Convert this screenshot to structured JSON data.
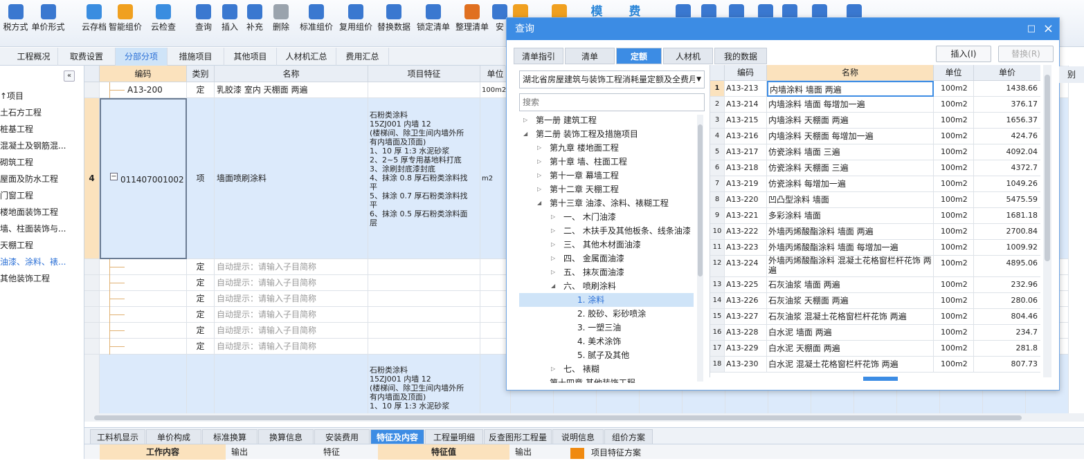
{
  "toolbar": {
    "buttons": [
      {
        "label": "税方式",
        "icon": "tax-mode-icon",
        "color": "#3a78d0"
      },
      {
        "label": "单价形式",
        "icon": "unit-price-form-icon",
        "color": "#3a78d0"
      },
      {
        "label": "云存档",
        "icon": "cloud-archive-icon",
        "color": "#3a8de0"
      },
      {
        "label": "智能组价",
        "icon": "smart-pricing-icon",
        "color": "#f0a020"
      },
      {
        "label": "云检查",
        "icon": "cloud-check-icon",
        "color": "#3a8de0"
      },
      {
        "label": "查询",
        "icon": "query-icon",
        "color": "#3a78d0"
      },
      {
        "label": "插入",
        "icon": "insert-icon",
        "color": "#3a78d0"
      },
      {
        "label": "补充",
        "icon": "supplement-icon",
        "color": "#3a78d0"
      },
      {
        "label": "删除",
        "icon": "delete-icon",
        "color": "#9aa3ad"
      },
      {
        "label": "标准组价",
        "icon": "standard-pricing-icon",
        "color": "#3a78d0"
      },
      {
        "label": "复用组价",
        "icon": "reuse-pricing-icon",
        "color": "#3a78d0"
      },
      {
        "label": "替换数据",
        "icon": "replace-data-icon",
        "color": "#3a78d0"
      },
      {
        "label": "锁定清单",
        "icon": "lock-icon",
        "color": "#3a78d0"
      },
      {
        "label": "整理清单",
        "icon": "organize-list-icon",
        "color": "#e07020"
      },
      {
        "label": "安",
        "icon": "install-icon",
        "color": "#3a78d0"
      },
      {
        "label": "",
        "icon": "coins-icon",
        "color": "#f0a020"
      },
      {
        "label": "",
        "icon": "gear-icon",
        "color": "#f0a020"
      },
      {
        "label": "",
        "icon": "template-icon",
        "color": "#2b86d8"
      },
      {
        "label": "",
        "icon": "fee-icon",
        "color": "#2b86d8"
      },
      {
        "label": "",
        "icon": "paint-icon",
        "color": "#3a78d0"
      },
      {
        "label": "",
        "icon": "structure-icon",
        "color": "#3a78d0"
      },
      {
        "label": "",
        "icon": "binoculars-icon",
        "color": "#3a78d0"
      },
      {
        "label": "",
        "icon": "filter-icon",
        "color": "#3a78d0"
      },
      {
        "label": "",
        "icon": "grid-icon",
        "color": "#3a78d0"
      },
      {
        "label": "",
        "icon": "search-doc-icon",
        "color": "#3a78d0"
      },
      {
        "label": "",
        "icon": "list-icon",
        "color": "#3a78d0"
      }
    ],
    "template_glyph": "模",
    "fee_glyph": "费"
  },
  "tabs": [
    "工程概况",
    "取费设置",
    "分部分项",
    "措施项目",
    "其他项目",
    "人材机汇总",
    "费用汇总"
  ],
  "active_tab": "分部分项",
  "left_tree": {
    "collapse_glyph": "«",
    "items": [
      "↑项目",
      "土石方工程",
      "桩基工程",
      "混凝土及钢筋混...",
      "砌筑工程",
      "屋面及防水工程",
      "门窗工程",
      "楼地面装饰工程",
      "墙、柱面装饰与...",
      "天棚工程",
      "油漆、涂料、裱...",
      "其他装饰工程"
    ],
    "active_item": "油漆、涂料、裱..."
  },
  "main_grid": {
    "headers": [
      "编码",
      "类别",
      "名称",
      "项目特征",
      "单位"
    ],
    "rows": [
      {
        "no": "",
        "code": "A13-200",
        "type": "定",
        "name": "乳胶漆 室内 天棚面 两遍",
        "feature": "",
        "unit": "100m2"
      },
      {
        "no": "4",
        "code": "011407001002",
        "type": "项",
        "name": "墙面喷刷涂料",
        "feature": "石粉类涂料\n15ZJ001 内墙 12\n(楼梯间、除卫生间内墙外所\n有内墙面及顶面)\n1、10 厚 1:3 水泥砂浆\n2、2~5 厚专用基地料打底\n3、涂刷封底漆封底\n4、抹涂 0.8 厚石粉类涂料找\n平\n5、抹涂 0.7 厚石粉类涂料找\n平\n6、抹涂 0.5 厚石粉类涂料面\n层",
        "unit": "m2"
      },
      {
        "no": "",
        "code": "",
        "type": "定",
        "name": "自动提示：请输入子目简称",
        "feature": "",
        "unit": ""
      },
      {
        "no": "",
        "code": "",
        "type": "定",
        "name": "自动提示：请输入子目简称",
        "feature": "",
        "unit": ""
      },
      {
        "no": "",
        "code": "",
        "type": "定",
        "name": "自动提示：请输入子目简称",
        "feature": "",
        "unit": ""
      },
      {
        "no": "",
        "code": "",
        "type": "定",
        "name": "自动提示：请输入子目简称",
        "feature": "",
        "unit": ""
      },
      {
        "no": "",
        "code": "",
        "type": "定",
        "name": "自动提示：请输入子目简称",
        "feature": "",
        "unit": ""
      },
      {
        "no": "",
        "code": "",
        "type": "定",
        "name": "自动提示：请输入子目简称",
        "feature": "",
        "unit": ""
      },
      {
        "no": "",
        "code": "",
        "type": "",
        "name": "",
        "feature": "石粉类涂料\n15ZJ001 内墙 12\n(楼梯间、除卫生间内墙外所\n有内墙面及顶面)\n1、10 厚 1:3 水泥砂浆",
        "unit": ""
      }
    ],
    "expand_glyph": "−"
  },
  "bottom_tabs": [
    "工料机显示",
    "单价构成",
    "标准换算",
    "换算信息",
    "安装费用",
    "特征及内容",
    "工程量明细",
    "反查图形工程量",
    "说明信息",
    "组价方案"
  ],
  "active_bottom_tab": "特征及内容",
  "bottom_panel": {
    "col1": "工作内容",
    "col2": "输出",
    "col3": "特征",
    "col4": "特征值",
    "col5": "输出",
    "col6": "项目特征方案"
  },
  "dialog": {
    "title": "查询",
    "restore_glyph": "□",
    "close_glyph": "×",
    "tabs": [
      "清单指引",
      "清单",
      "定额",
      "人材机",
      "我的数据"
    ],
    "active_tab": "定额",
    "insert_button": "插入(I)",
    "replace_button": "替换(R)",
    "quota_select": "湖北省房屋建筑与装饰工程消耗量定额及全费月",
    "search_placeholder": "搜索",
    "tree": [
      {
        "level": 0,
        "arrow": "▷",
        "label": "第一册  建筑工程"
      },
      {
        "level": 0,
        "arrow": "◢",
        "label": "第二册  装饰工程及措施项目"
      },
      {
        "level": 1,
        "arrow": "▷",
        "label": "第九章  楼地面工程"
      },
      {
        "level": 1,
        "arrow": "▷",
        "label": "第十章  墙、柱面工程"
      },
      {
        "level": 1,
        "arrow": "▷",
        "label": "第十一章  幕墙工程"
      },
      {
        "level": 1,
        "arrow": "▷",
        "label": "第十二章  天棚工程"
      },
      {
        "level": 1,
        "arrow": "◢",
        "label": "第十三章  油漆、涂料、裱糊工程"
      },
      {
        "level": 2,
        "arrow": "▷",
        "label": "一、  木门油漆"
      },
      {
        "level": 2,
        "arrow": "▷",
        "label": "二、  木扶手及其他板条、线条油漆"
      },
      {
        "level": 2,
        "arrow": "▷",
        "label": "三、  其他木材面油漆"
      },
      {
        "level": 2,
        "arrow": "▷",
        "label": "四、  金属面油漆"
      },
      {
        "level": 2,
        "arrow": "▷",
        "label": "五、  抹灰面油漆"
      },
      {
        "level": 2,
        "arrow": "◢",
        "label": "六、  喷刷涂料"
      },
      {
        "level": 3,
        "arrow": "",
        "label": "1. 涂料"
      },
      {
        "level": 3,
        "arrow": "",
        "label": "2. 胶砂、彩砂喷涂"
      },
      {
        "level": 3,
        "arrow": "",
        "label": "3. 一塑三油"
      },
      {
        "level": 3,
        "arrow": "",
        "label": "4. 美术涂饰"
      },
      {
        "level": 3,
        "arrow": "",
        "label": "5. 腻子及其他"
      },
      {
        "level": 2,
        "arrow": "▷",
        "label": "七、  裱糊"
      },
      {
        "level": 1,
        "arrow": "",
        "label": "第十四章  其他装饰工程"
      }
    ],
    "tree_selected": "1. 涂料",
    "grid_headers": [
      "",
      "编码",
      "名称",
      "单位",
      "单价"
    ],
    "rows": [
      {
        "no": "1",
        "code": "A13-213",
        "name": "内墙涂料 墙面 两遍",
        "unit": "100m2",
        "price": "1438.66"
      },
      {
        "no": "2",
        "code": "A13-214",
        "name": "内墙涂料 墙面 每增加一遍",
        "unit": "100m2",
        "price": "376.17"
      },
      {
        "no": "3",
        "code": "A13-215",
        "name": "内墙涂料 天棚面 两遍",
        "unit": "100m2",
        "price": "1656.37"
      },
      {
        "no": "4",
        "code": "A13-216",
        "name": "内墙涂料 天棚面 每增加一遍",
        "unit": "100m2",
        "price": "424.76"
      },
      {
        "no": "5",
        "code": "A13-217",
        "name": "仿瓷涂料 墙面 三遍",
        "unit": "100m2",
        "price": "4092.04"
      },
      {
        "no": "6",
        "code": "A13-218",
        "name": "仿瓷涂料 天棚面 三遍",
        "unit": "100m2",
        "price": "4372.7"
      },
      {
        "no": "7",
        "code": "A13-219",
        "name": "仿瓷涂料 每增加一遍",
        "unit": "100m2",
        "price": "1049.26"
      },
      {
        "no": "8",
        "code": "A13-220",
        "name": "凹凸型涂料 墙面",
        "unit": "100m2",
        "price": "5475.59"
      },
      {
        "no": "9",
        "code": "A13-221",
        "name": "多彩涂料 墙面",
        "unit": "100m2",
        "price": "1681.18"
      },
      {
        "no": "10",
        "code": "A13-222",
        "name": "外墙丙烯酸酯涂料 墙面 两遍",
        "unit": "100m2",
        "price": "2700.84"
      },
      {
        "no": "11",
        "code": "A13-223",
        "name": "外墙丙烯酸酯涂料 墙面 每增加一遍",
        "unit": "100m2",
        "price": "1009.92"
      },
      {
        "no": "12",
        "code": "A13-224",
        "name": "外墙丙烯酸酯涂料 混凝土花格窗栏杆花饰 两遍",
        "unit": "100m2",
        "price": "4895.06"
      },
      {
        "no": "13",
        "code": "A13-225",
        "name": "石灰油浆 墙面 两遍",
        "unit": "100m2",
        "price": "232.96"
      },
      {
        "no": "14",
        "code": "A13-226",
        "name": "石灰油浆 天棚面 两遍",
        "unit": "100m2",
        "price": "280.06"
      },
      {
        "no": "15",
        "code": "A13-227",
        "name": "石灰油浆 混凝土花格窗栏杆花饰 两遍",
        "unit": "100m2",
        "price": "804.46"
      },
      {
        "no": "16",
        "code": "A13-228",
        "name": "白水泥 墙面 两遍",
        "unit": "100m2",
        "price": "234.7"
      },
      {
        "no": "17",
        "code": "A13-229",
        "name": "白水泥 天棚面 两遍",
        "unit": "100m2",
        "price": "281.8"
      },
      {
        "no": "18",
        "code": "A13-230",
        "name": "白水泥 混凝土花格窗栏杆花饰 两遍",
        "unit": "100m2",
        "price": "807.73"
      }
    ],
    "behind_header": "别"
  },
  "colors": {
    "accent": "#3c8ce4",
    "selected_header": "#fbe2bd",
    "selected_row": "#dceafb",
    "toolbar_bg": "#eef3f9"
  }
}
